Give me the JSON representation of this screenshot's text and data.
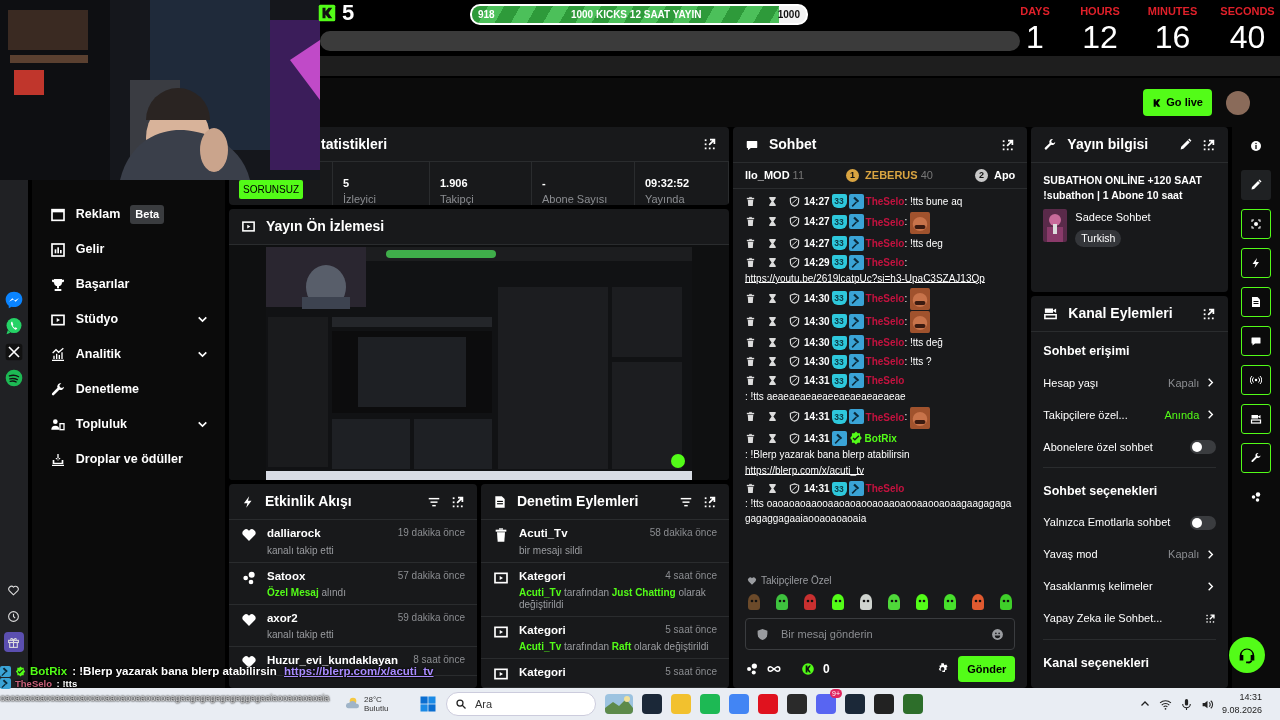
{
  "overlay": {
    "kicks": {
      "count": "5"
    },
    "goal": {
      "start": "918",
      "label": "1000 KICKS 12 SAAT YAYIN",
      "end": "1000",
      "level": 0.918
    },
    "countdown": [
      {
        "unit": "DAYS",
        "value": "1"
      },
      {
        "unit": "HOURS",
        "value": "12"
      },
      {
        "unit": "MINUTES",
        "value": "16"
      },
      {
        "unit": "SECONDS",
        "value": "40"
      }
    ],
    "chat": [
      {
        "user": "BotRix",
        "verified": true,
        "color": "#53fc18",
        "text": " : !Blerp yazarak bana blerp atabilirsin",
        "link": "https://blerp.com/x/acuti_tv"
      },
      {
        "user": "TheSelo",
        "verified": false,
        "color": "#c8607a",
        "text": " : !tts",
        "continuation": "oaoaoaoaaooaaoaoaooaoaaoaooaaooaoaagaagagagagagaggagaaiaooaoaoaoaia"
      }
    ]
  },
  "header": {
    "go_live": "Go live"
  },
  "side_apps": [
    {
      "kind": "messenger",
      "selected": false
    },
    {
      "kind": "whatsapp",
      "selected": false
    },
    {
      "kind": "x",
      "selected": false
    },
    {
      "kind": "spotify",
      "selected": false
    }
  ],
  "side_tools": [
    {
      "kind": "heart",
      "selected": false
    },
    {
      "kind": "clock",
      "selected": false
    },
    {
      "kind": "gift",
      "selected": true
    }
  ],
  "nav": {
    "items": [
      {
        "kind": "ad",
        "label": "Reklam",
        "badge": "Beta",
        "expandable": false
      },
      {
        "kind": "revenue",
        "label": "Gelir",
        "expandable": false
      },
      {
        "kind": "trophy",
        "label": "Başarılar",
        "expandable": false
      },
      {
        "kind": "studio",
        "label": "Stüdyo",
        "expandable": true
      },
      {
        "kind": "analytics",
        "label": "Analitik",
        "expandable": true
      },
      {
        "kind": "wrench",
        "label": "Denetleme",
        "expandable": false
      },
      {
        "kind": "community",
        "label": "Topluluk",
        "expandable": true
      },
      {
        "kind": "drops",
        "label": "Droplar ve ödüller",
        "expandable": false
      }
    ]
  },
  "stats": {
    "title": "tatistikleri",
    "status": "SORUNSUZ",
    "items": [
      {
        "value": "5",
        "label": "İzleyici"
      },
      {
        "value": "1.906",
        "label": "Takipçi"
      },
      {
        "value": "-",
        "label": "Abone Sayısı"
      },
      {
        "value": "09:32:52",
        "label": "Yayında"
      }
    ]
  },
  "preview": {
    "title": "Yayın Ön İzlemesi"
  },
  "activity": {
    "title": "Etkinlik Akışı",
    "items": [
      {
        "kind": "follow",
        "user": "dalliarock",
        "time": "19 dakika önce",
        "detail": [
          {
            "text": "kanalı takip etti",
            "highlight": false
          }
        ]
      },
      {
        "kind": "message",
        "user": "Satoox",
        "time": "57 dakika önce",
        "detail": [
          {
            "text": "Özel Mesaj",
            "highlight": true
          },
          {
            "text": " alındı",
            "highlight": false
          }
        ]
      },
      {
        "kind": "follow",
        "user": "axor2",
        "time": "59 dakika önce",
        "detail": [
          {
            "text": "kanalı takip etti",
            "highlight": false
          }
        ]
      },
      {
        "kind": "follow",
        "user": "Huzur_evi_kundaklayan",
        "time": "8 saat önce"
      }
    ]
  },
  "moderation": {
    "title": "Denetim Eylemleri",
    "items": [
      {
        "kind": "delete",
        "title": "Acuti_Tv",
        "time": "58 dakika önce",
        "detail": [
          {
            "text": "bir mesajı sildi",
            "highlight": false
          }
        ]
      },
      {
        "kind": "category",
        "title": "Kategori",
        "time": "4 saat önce",
        "detail": [
          {
            "text": "Acuti_Tv",
            "highlight": true
          },
          {
            "text": " tarafından ",
            "highlight": false
          },
          {
            "text": "Just Chatting",
            "highlight": true
          },
          {
            "text": " olarak değiştirildi",
            "highlight": false
          }
        ]
      },
      {
        "kind": "category",
        "title": "Kategori",
        "time": "5 saat önce",
        "detail": [
          {
            "text": "Acuti_Tv",
            "highlight": true
          },
          {
            "text": " tarafından ",
            "highlight": false
          },
          {
            "text": "Raft",
            "highlight": true
          },
          {
            "text": "  olarak değiştirildi",
            "highlight": false
          }
        ]
      },
      {
        "kind": "category",
        "title": "Kategori",
        "time": "5 saat önce"
      }
    ]
  },
  "chat": {
    "title": "Sohbet",
    "leaders": [
      {
        "name": "llo_MOD",
        "count": "11"
      },
      {
        "rank": "1",
        "color": "#d9a441",
        "name": "ZEBERUS",
        "count": "40"
      },
      {
        "rank": "2",
        "color": "#c8c8c8",
        "name": "Apo"
      }
    ],
    "messages": [
      {
        "time": "14:27",
        "sub": "33",
        "moderator": true,
        "verified": false,
        "user": "TheSelo",
        "color": "#c4123f",
        "text": ": !tts bune aq",
        "emote": false
      },
      {
        "time": "14:27",
        "sub": "33",
        "moderator": true,
        "verified": false,
        "user": "TheSelo",
        "color": "#c4123f",
        "text": ":",
        "emote": true
      },
      {
        "time": "14:27",
        "sub": "33",
        "moderator": true,
        "verified": false,
        "user": "TheSelo",
        "color": "#c4123f",
        "text": ": !tts deg",
        "emote": false
      },
      {
        "time": "14:29",
        "sub": "33",
        "moderator": true,
        "verified": false,
        "user": "TheSelo",
        "color": "#c4123f",
        "text": ":",
        "link": "https://youtu.be/2619lcatpUc?si=h3-UpaC3SZAJ13Qp",
        "emote": false
      },
      {
        "time": "14:30",
        "sub": "33",
        "moderator": true,
        "verified": false,
        "user": "TheSelo",
        "color": "#c4123f",
        "text": ":",
        "emote": true
      },
      {
        "time": "14:30",
        "sub": "33",
        "moderator": true,
        "verified": false,
        "user": "TheSelo",
        "color": "#c4123f",
        "text": ":",
        "emote": true
      },
      {
        "time": "14:30",
        "sub": "33",
        "moderator": true,
        "verified": false,
        "user": "TheSelo",
        "color": "#c4123f",
        "text": ": !tts değ",
        "emote": false
      },
      {
        "time": "14:30",
        "sub": "33",
        "moderator": true,
        "verified": false,
        "user": "TheSelo",
        "color": "#c4123f",
        "text": ": !tts ?",
        "emote": false
      },
      {
        "time": "14:31",
        "sub": "33",
        "moderator": true,
        "verified": false,
        "user": "TheSelo",
        "color": "#c4123f",
        "text": ": !tts aeaeaeaeaeaeeaeaeaeaeaeae",
        "emote": false
      },
      {
        "time": "14:31",
        "sub": "33",
        "moderator": true,
        "verified": false,
        "user": "TheSelo",
        "color": "#c4123f",
        "text": ":",
        "emote": true
      },
      {
        "time": "14:31",
        "moderator": true,
        "verified": true,
        "user": "BotRix",
        "color": "#53fc18",
        "text": ": !Blerp yazarak bana blerp atabilirsin",
        "link": "https://blerp.com/x/acuti_tv",
        "emote": false
      },
      {
        "time": "14:31",
        "sub": "33",
        "moderator": true,
        "verified": false,
        "user": "TheSelo",
        "color": "#c4123f",
        "text": ": !tts oaoaoaoaaooaaoaoaooaoaaoaooaaooaoaagaagagagagagaggagaaiaooaoaoaoaia",
        "emote": false
      }
    ],
    "followers_label": "Takipçilere Özel",
    "emotes": [
      {
        "color": "#6b4a2a"
      },
      {
        "color": "#3ec23e"
      },
      {
        "color": "#c83030"
      },
      {
        "color": "#53fc18"
      },
      {
        "color": "#cfd3cf"
      },
      {
        "color": "#4fd83a"
      },
      {
        "color": "#53fc18"
      },
      {
        "color": "#47e02c"
      },
      {
        "color": "#e05a30"
      },
      {
        "color": "#3fcf2a"
      }
    ],
    "placeholder": "Bir mesaj gönderin",
    "kicks": "0",
    "send": "Gönder"
  },
  "stream_info": {
    "title": "Yayın bilgisi",
    "stream_title": "SUBATHON ONLİNE +120 SAAT !subathon | 1 Abone 10 saat",
    "category": "Sadece Sohbet",
    "language": "Turkish"
  },
  "channel_actions": {
    "title": "Kanal Eylemleri",
    "sections": [
      {
        "title": "Sohbet erişimi",
        "rows": [
          {
            "kind": "select",
            "label": "Hesap yaşı",
            "value": "Kapalı",
            "active": false
          },
          {
            "kind": "select",
            "label": "Takipçilere özel...",
            "value": "Anında",
            "active": true
          },
          {
            "kind": "toggle",
            "label": "Abonelere özel sohbet",
            "on": false
          }
        ]
      },
      {
        "title": "Sohbet seçenekleri",
        "rows": [
          {
            "kind": "toggle",
            "label": "Yalnızca Emotlarla sohbet",
            "on": false
          },
          {
            "kind": "select",
            "label": "Yavaş mod",
            "value": "Kapalı",
            "active": false
          },
          {
            "kind": "link",
            "label": "Yasaklanmış kelimeler"
          },
          {
            "kind": "external",
            "label": "Yapay Zeka ile Sohbet..."
          }
        ]
      },
      {
        "title": "Kanal seçenekleri"
      }
    ]
  },
  "rail": [
    {
      "kind": "info",
      "outlined": false,
      "selected": false
    },
    {
      "kind": "pencil",
      "outlined": false,
      "selected": true
    },
    {
      "kind": "camera",
      "outlined": true,
      "selected": false
    },
    {
      "kind": "bolt",
      "outlined": true,
      "selected": false
    },
    {
      "kind": "doc",
      "outlined": true,
      "selected": false
    },
    {
      "kind": "chat",
      "outlined": true,
      "selected": false
    },
    {
      "kind": "broadcast",
      "outlined": true,
      "selected": false
    },
    {
      "kind": "channel",
      "outlined": true,
      "selected": false
    },
    {
      "kind": "wrench",
      "outlined": true,
      "selected": false
    },
    {
      "kind": "dots",
      "outlined": false,
      "selected": false
    }
  ],
  "taskbar": {
    "weather": {
      "temp": "28°C",
      "desc": "Bulutlu"
    },
    "search": {
      "placeholder": "Ara"
    },
    "apps": [
      {
        "color": "#1b2838"
      },
      {
        "color": "#f2c12e"
      },
      {
        "color": "#1db954"
      },
      {
        "color": "#4285f4"
      },
      {
        "color": "#e0121e"
      },
      {
        "color": "#2a2a2a"
      },
      {
        "color": "#5865f2",
        "badge": "9+"
      },
      {
        "color": "#1b2838"
      },
      {
        "color": "#222222"
      },
      {
        "color": "#2d6e2a"
      }
    ],
    "time": "14:31",
    "date": "9.08.2026"
  }
}
